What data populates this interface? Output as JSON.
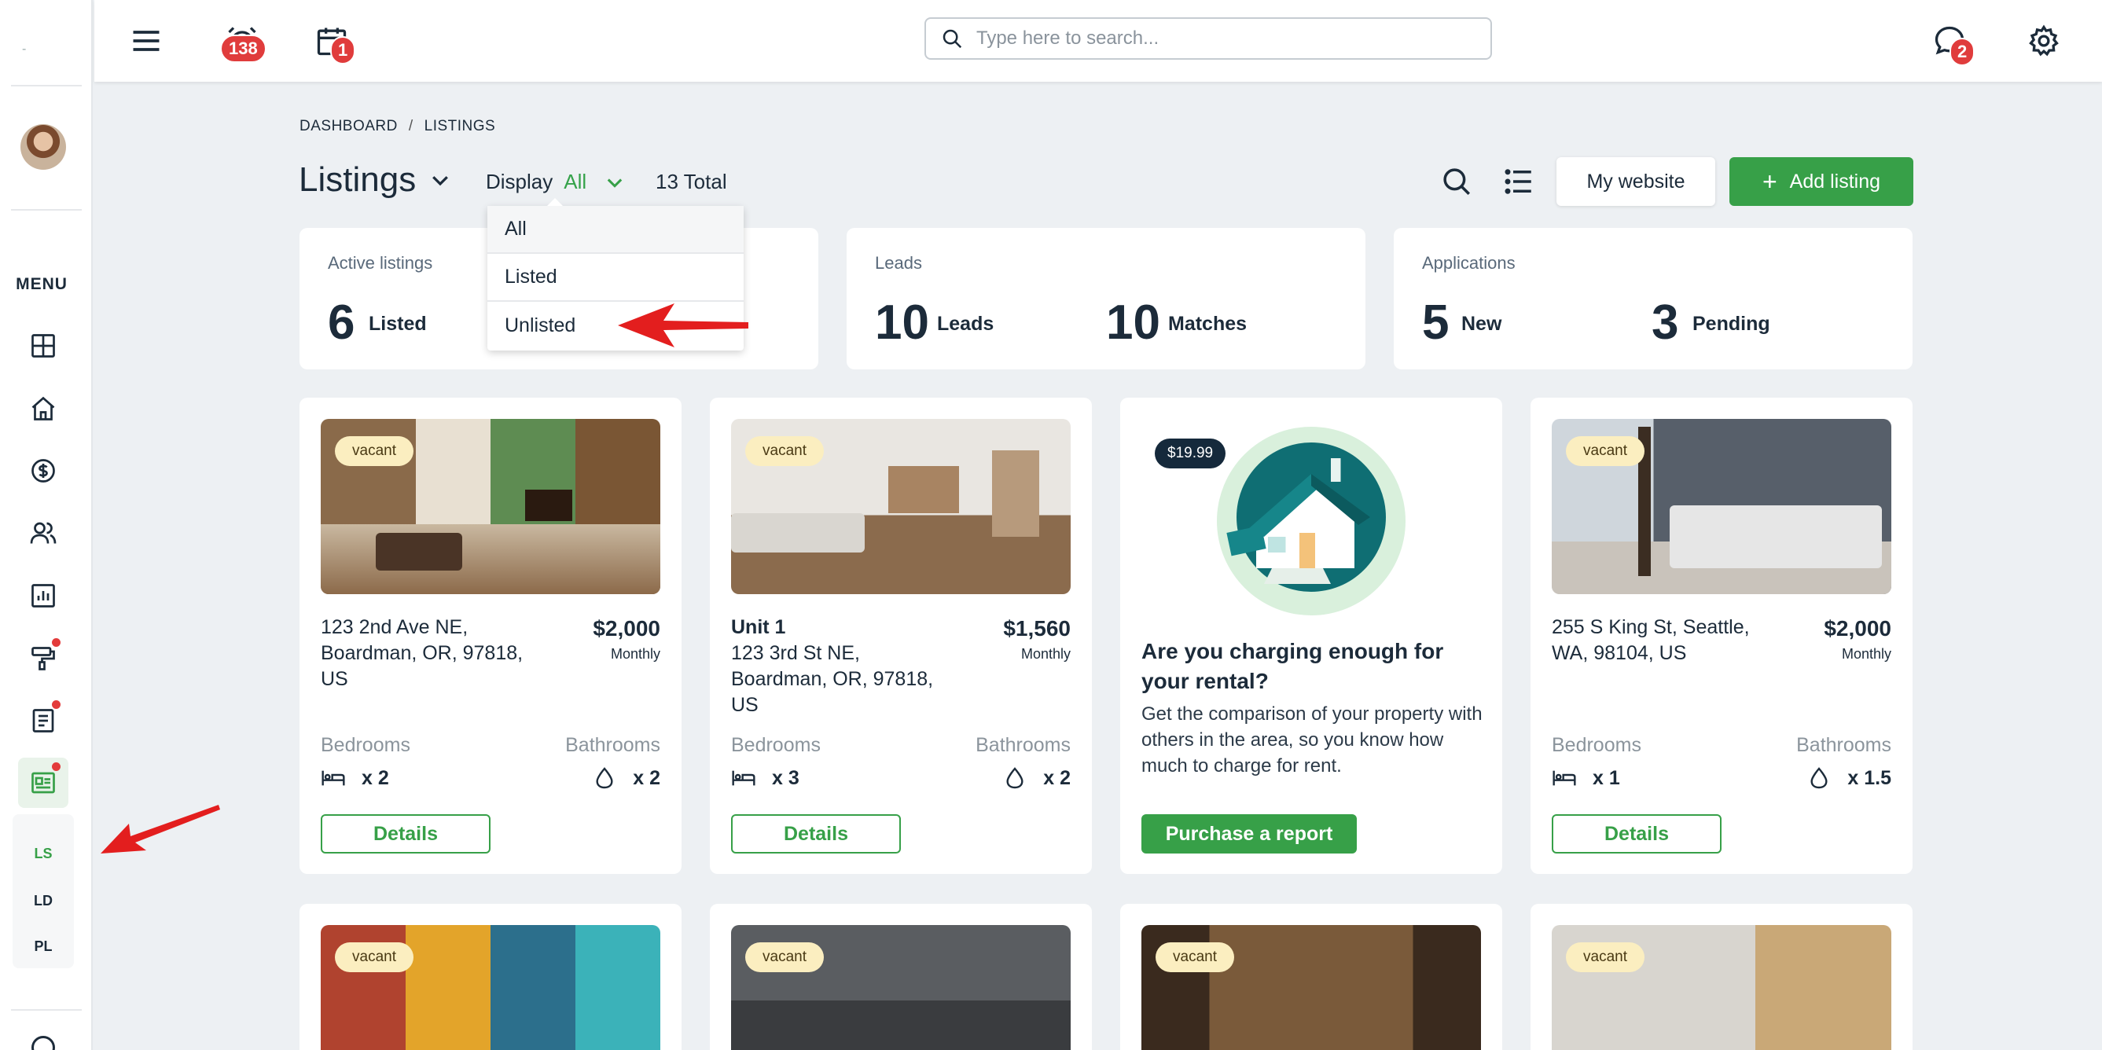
{
  "sidebar": {
    "logo_text": "-",
    "menu_label": "MENU",
    "sub_items": [
      "LS",
      "LD",
      "PL"
    ],
    "icons": [
      "dashboard-icon",
      "home-icon",
      "dollar-icon",
      "users-icon",
      "chart-icon",
      "paint-roller-icon",
      "document-icon",
      "listing-icon"
    ]
  },
  "topbar": {
    "notifications_count": "138",
    "calendar_count": "1",
    "search_placeholder": "Type here to search...",
    "messages_count": "2"
  },
  "breadcrumb": {
    "dashboard": "DASHBOARD",
    "separator": "/",
    "listings": "LISTINGS"
  },
  "header": {
    "title": "Listings",
    "display_label": "Display",
    "display_value": "All",
    "total": "13 Total",
    "my_website": "My website",
    "add_listing": "Add listing",
    "add_symbol": "+"
  },
  "dropdown": {
    "options": [
      "All",
      "Listed",
      "Unlisted"
    ]
  },
  "stats": {
    "active": {
      "title": "Active listings",
      "num": "6",
      "label": "Listed"
    },
    "leads": {
      "title": "Leads",
      "num1": "10",
      "label1": "Leads",
      "num2": "10",
      "label2": "Matches"
    },
    "applications": {
      "title": "Applications",
      "num1": "5",
      "label1": "New",
      "num2": "3",
      "label2": "Pending"
    }
  },
  "listings": [
    {
      "tag": "vacant",
      "address": "123 2nd Ave NE, Boardman, OR, 97818, US",
      "price": "$2,000",
      "period": "Monthly",
      "bedrooms_label": "Bedrooms",
      "bathrooms_label": "Bathrooms",
      "bedrooms": "x 2",
      "bathrooms": "x 2",
      "button": "Details"
    },
    {
      "tag": "vacant",
      "unit": "Unit 1",
      "address": "123 3rd St NE, Boardman, OR, 97818, US",
      "price": "$1,560",
      "period": "Monthly",
      "bedrooms_label": "Bedrooms",
      "bathrooms_label": "Bathrooms",
      "bedrooms": "x 3",
      "bathrooms": "x 2",
      "button": "Details"
    },
    {
      "tag": "vacant",
      "address": "255 S King St, Seattle, WA, 98104, US",
      "price": "$2,000",
      "period": "Monthly",
      "bedrooms_label": "Bedrooms",
      "bathrooms_label": "Bathrooms",
      "bedrooms": "x 1",
      "bathrooms": "x 1.5",
      "button": "Details"
    }
  ],
  "promo": {
    "price": "$19.99",
    "title": "Are you charging enough for your rental?",
    "description": "Get the comparison of your property with others in the area, so you know how much to charge for rent.",
    "button": "Purchase a report"
  },
  "second_row_tags": [
    "vacant",
    "vacant",
    "vacant",
    "vacant"
  ],
  "colors": {
    "accent_green": "#37a048",
    "badge_red": "#e03c3c",
    "vacant_tag": "#fbeec0",
    "dark_navy": "#15293b"
  }
}
